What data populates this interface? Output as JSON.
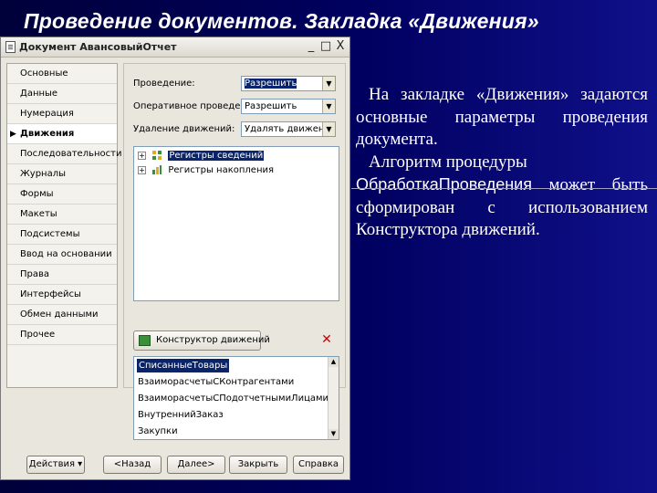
{
  "slide": {
    "title": "Проведение документов. Закладка «Движения»",
    "paragraph1": "На закладке «Движения» задаются основные параметры проведения документа.",
    "paragraph2_start": "Алгоритм процедуры",
    "paragraph2_code": "ОбработкаПроведения",
    "paragraph2_end": "может быть сформирован с использованием Конструктора движений."
  },
  "window": {
    "title": "Документ АвансовыйОтчет",
    "controls": {
      "minimize": "_",
      "maximize": "□",
      "close": "X"
    }
  },
  "nav": {
    "items": [
      {
        "label": "Основные"
      },
      {
        "label": "Данные"
      },
      {
        "label": "Нумерация"
      },
      {
        "label": "Движения",
        "active": true
      },
      {
        "label": "Последовательности"
      },
      {
        "label": "Журналы"
      },
      {
        "label": "Формы"
      },
      {
        "label": "Макеты"
      },
      {
        "label": "Подсистемы"
      },
      {
        "label": "Ввод на основании"
      },
      {
        "label": "Права"
      },
      {
        "label": "Интерфейсы"
      },
      {
        "label": "Обмен данными"
      },
      {
        "label": "Прочее"
      }
    ]
  },
  "form": {
    "posting_label": "Проведение:",
    "posting_value": "Разрешить",
    "realtime_label": "Оперативное проведение:",
    "realtime_value": "Разрешить",
    "delete_label": "Удаление движений:",
    "delete_value": "Удалять движения а"
  },
  "tree": {
    "items": [
      {
        "label": "Регистры сведений",
        "selected": true
      },
      {
        "label": "Регистры накопления",
        "selected": false
      }
    ]
  },
  "constructor_button": "Конструктор движений",
  "registers_list": [
    {
      "label": "СписанныеТовары",
      "selected": true
    },
    {
      "label": "ВзаиморасчетыСКонтрагентами"
    },
    {
      "label": "ВзаиморасчетыСПодотчетнымиЛицами"
    },
    {
      "label": "ВнутреннийЗаказ"
    },
    {
      "label": "Закупки"
    }
  ],
  "buttons": {
    "actions": "Действия",
    "back": "<Назад",
    "next": "Далее>",
    "close": "Закрыть",
    "help": "Справка"
  },
  "colors": {
    "background": "#000060",
    "selection": "#0a246a",
    "window": "#e9e6de"
  }
}
